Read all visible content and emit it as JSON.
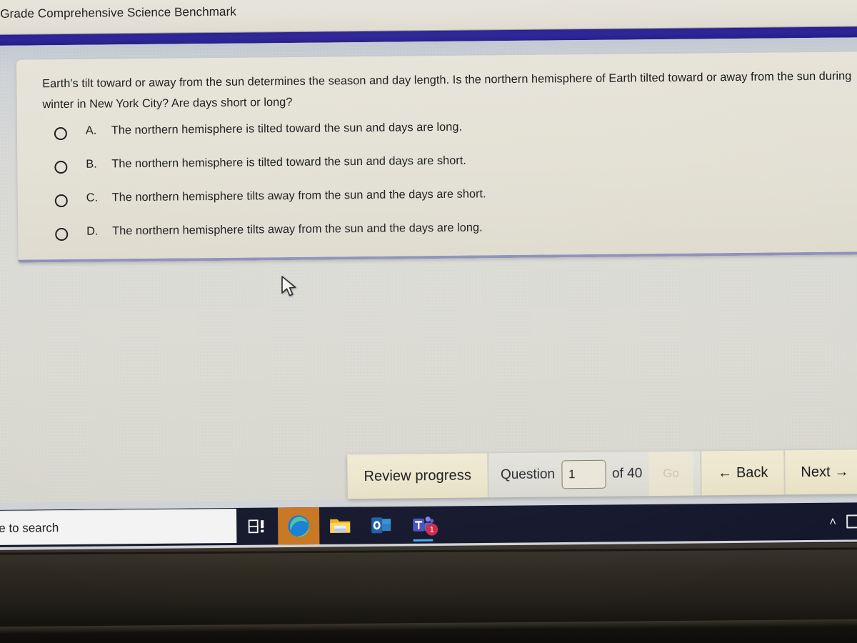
{
  "browser": {
    "tab_title": "Grade Comprehensive Science Benchmark"
  },
  "question": {
    "stem": "Earth's tilt toward or away from the sun determines the season and day length. Is the northern hemisphere of Earth tilted toward or away from the sun during winter in New York City? Are days short or long?",
    "options": [
      {
        "letter": "A.",
        "text": "The northern hemisphere is tilted toward the sun and days are long.",
        "selected": false
      },
      {
        "letter": "B.",
        "text": "The northern hemisphere is tilted toward the sun and days are short.",
        "selected": false
      },
      {
        "letter": "C.",
        "text": "The northern hemisphere tilts away from the sun and the days are short.",
        "selected": false
      },
      {
        "letter": "D.",
        "text": "The northern hemisphere tilts away from the sun and the days are long.",
        "selected": false
      }
    ]
  },
  "navbar": {
    "review_label": "Review progress",
    "question_label": "Question",
    "question_number": "1",
    "question_number_placeholder": "1",
    "of_label": "of 40",
    "go_label": "Go",
    "back_label": "Back",
    "back_arrow": "←",
    "next_label": "Next",
    "next_arrow": "→"
  },
  "taskbar": {
    "search_text": "e to search",
    "items": [
      {
        "name": "task-view",
        "label": "Task View"
      },
      {
        "name": "microsoft-edge",
        "label": "Microsoft Edge",
        "active": true
      },
      {
        "name": "file-explorer",
        "label": "File Explorer"
      },
      {
        "name": "outlook",
        "label": "Outlook"
      },
      {
        "name": "microsoft-teams",
        "label": "Microsoft Teams",
        "badge": "1"
      }
    ],
    "tray_chevron": "˄"
  },
  "colors": {
    "accent_blue_bar": "#2b2398",
    "card_background": "#e3e0d4",
    "card_bottom_border": "#8d8ebb",
    "button_cream": "#ece6cd",
    "taskbar": "#15182c",
    "edge_active_highlight": "#c87722",
    "teams_badge": "#cc2a4a"
  }
}
